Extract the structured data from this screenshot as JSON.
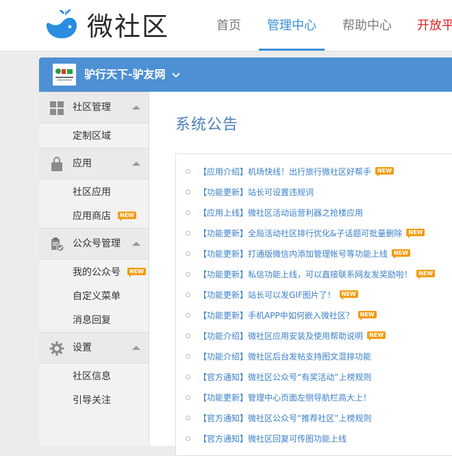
{
  "header": {
    "brand": "微社区",
    "nav": [
      {
        "label": "首页"
      },
      {
        "label": "管理中心"
      },
      {
        "label": "帮助中心"
      },
      {
        "label": "开放平"
      }
    ],
    "active_nav": "管理中心",
    "colors": {
      "accent": "#3a8fd6",
      "red": "#e02020"
    }
  },
  "community": {
    "name": "驴行天下-驴友网",
    "logo_text": "驴天下"
  },
  "sidebar": {
    "badge": "NEW",
    "sections": [
      {
        "title": "社区管理",
        "icon": "grid-icon",
        "items": [
          {
            "label": "定制区域"
          }
        ]
      },
      {
        "title": "应用",
        "icon": "bag-icon",
        "items": [
          {
            "label": "社区应用"
          },
          {
            "label": "应用商店"
          }
        ]
      },
      {
        "title": "公众号管理",
        "icon": "clipboard-check-icon",
        "items": [
          {
            "label": "我的公众号"
          },
          {
            "label": "自定义菜单"
          },
          {
            "label": "消息回复"
          }
        ]
      },
      {
        "title": "设置",
        "icon": "gear-icon",
        "items": [
          {
            "label": "社区信息"
          },
          {
            "label": "引导关注"
          }
        ]
      }
    ]
  },
  "content": {
    "title": "系统公告",
    "notices": [
      {
        "tag": "【应用介绍】",
        "text": "机场快线！出行旅行微社区好帮手",
        "new": true
      },
      {
        "tag": "【功能更新】",
        "text": "站长可设置违规词",
        "new": false
      },
      {
        "tag": "【应用上线】",
        "text": "微社区活动运营利器之抢楼应用",
        "new": false
      },
      {
        "tag": "【功能更新】",
        "text": "全局活动社区排行优化&子话题可批量删除",
        "new": true
      },
      {
        "tag": "【功能更新】",
        "text": "打通版微信内添加管理帐号等功能上线",
        "new": true
      },
      {
        "tag": "【功能更新】",
        "text": "私信功能上线，可以直接联系网友发奖励啦！",
        "new": true
      },
      {
        "tag": "【功能更新】",
        "text": "站长可以发GIF图片了！",
        "new": true
      },
      {
        "tag": "【功能更新】",
        "text": "手机APP中如何嵌入微社区？",
        "new": true
      },
      {
        "tag": "【功能介绍】",
        "text": "微社区应用安装及使用帮助说明",
        "new": true
      },
      {
        "tag": "【功能介绍】",
        "text": "微社区后台发帖支持图文混排功能",
        "new": false
      },
      {
        "tag": "【官方通知】",
        "text": "微社区公众号“有奖活动”上榜规则",
        "new": false
      },
      {
        "tag": "【功能更新】",
        "text": "管理中心页面左侧导航栏高大上！",
        "new": false
      },
      {
        "tag": "【官方通知】",
        "text": "微社区公众号“推荐社区”上榜规则",
        "new": false
      },
      {
        "tag": "【官方通知】",
        "text": "微社区回复可传图功能上线",
        "new": false
      }
    ]
  }
}
